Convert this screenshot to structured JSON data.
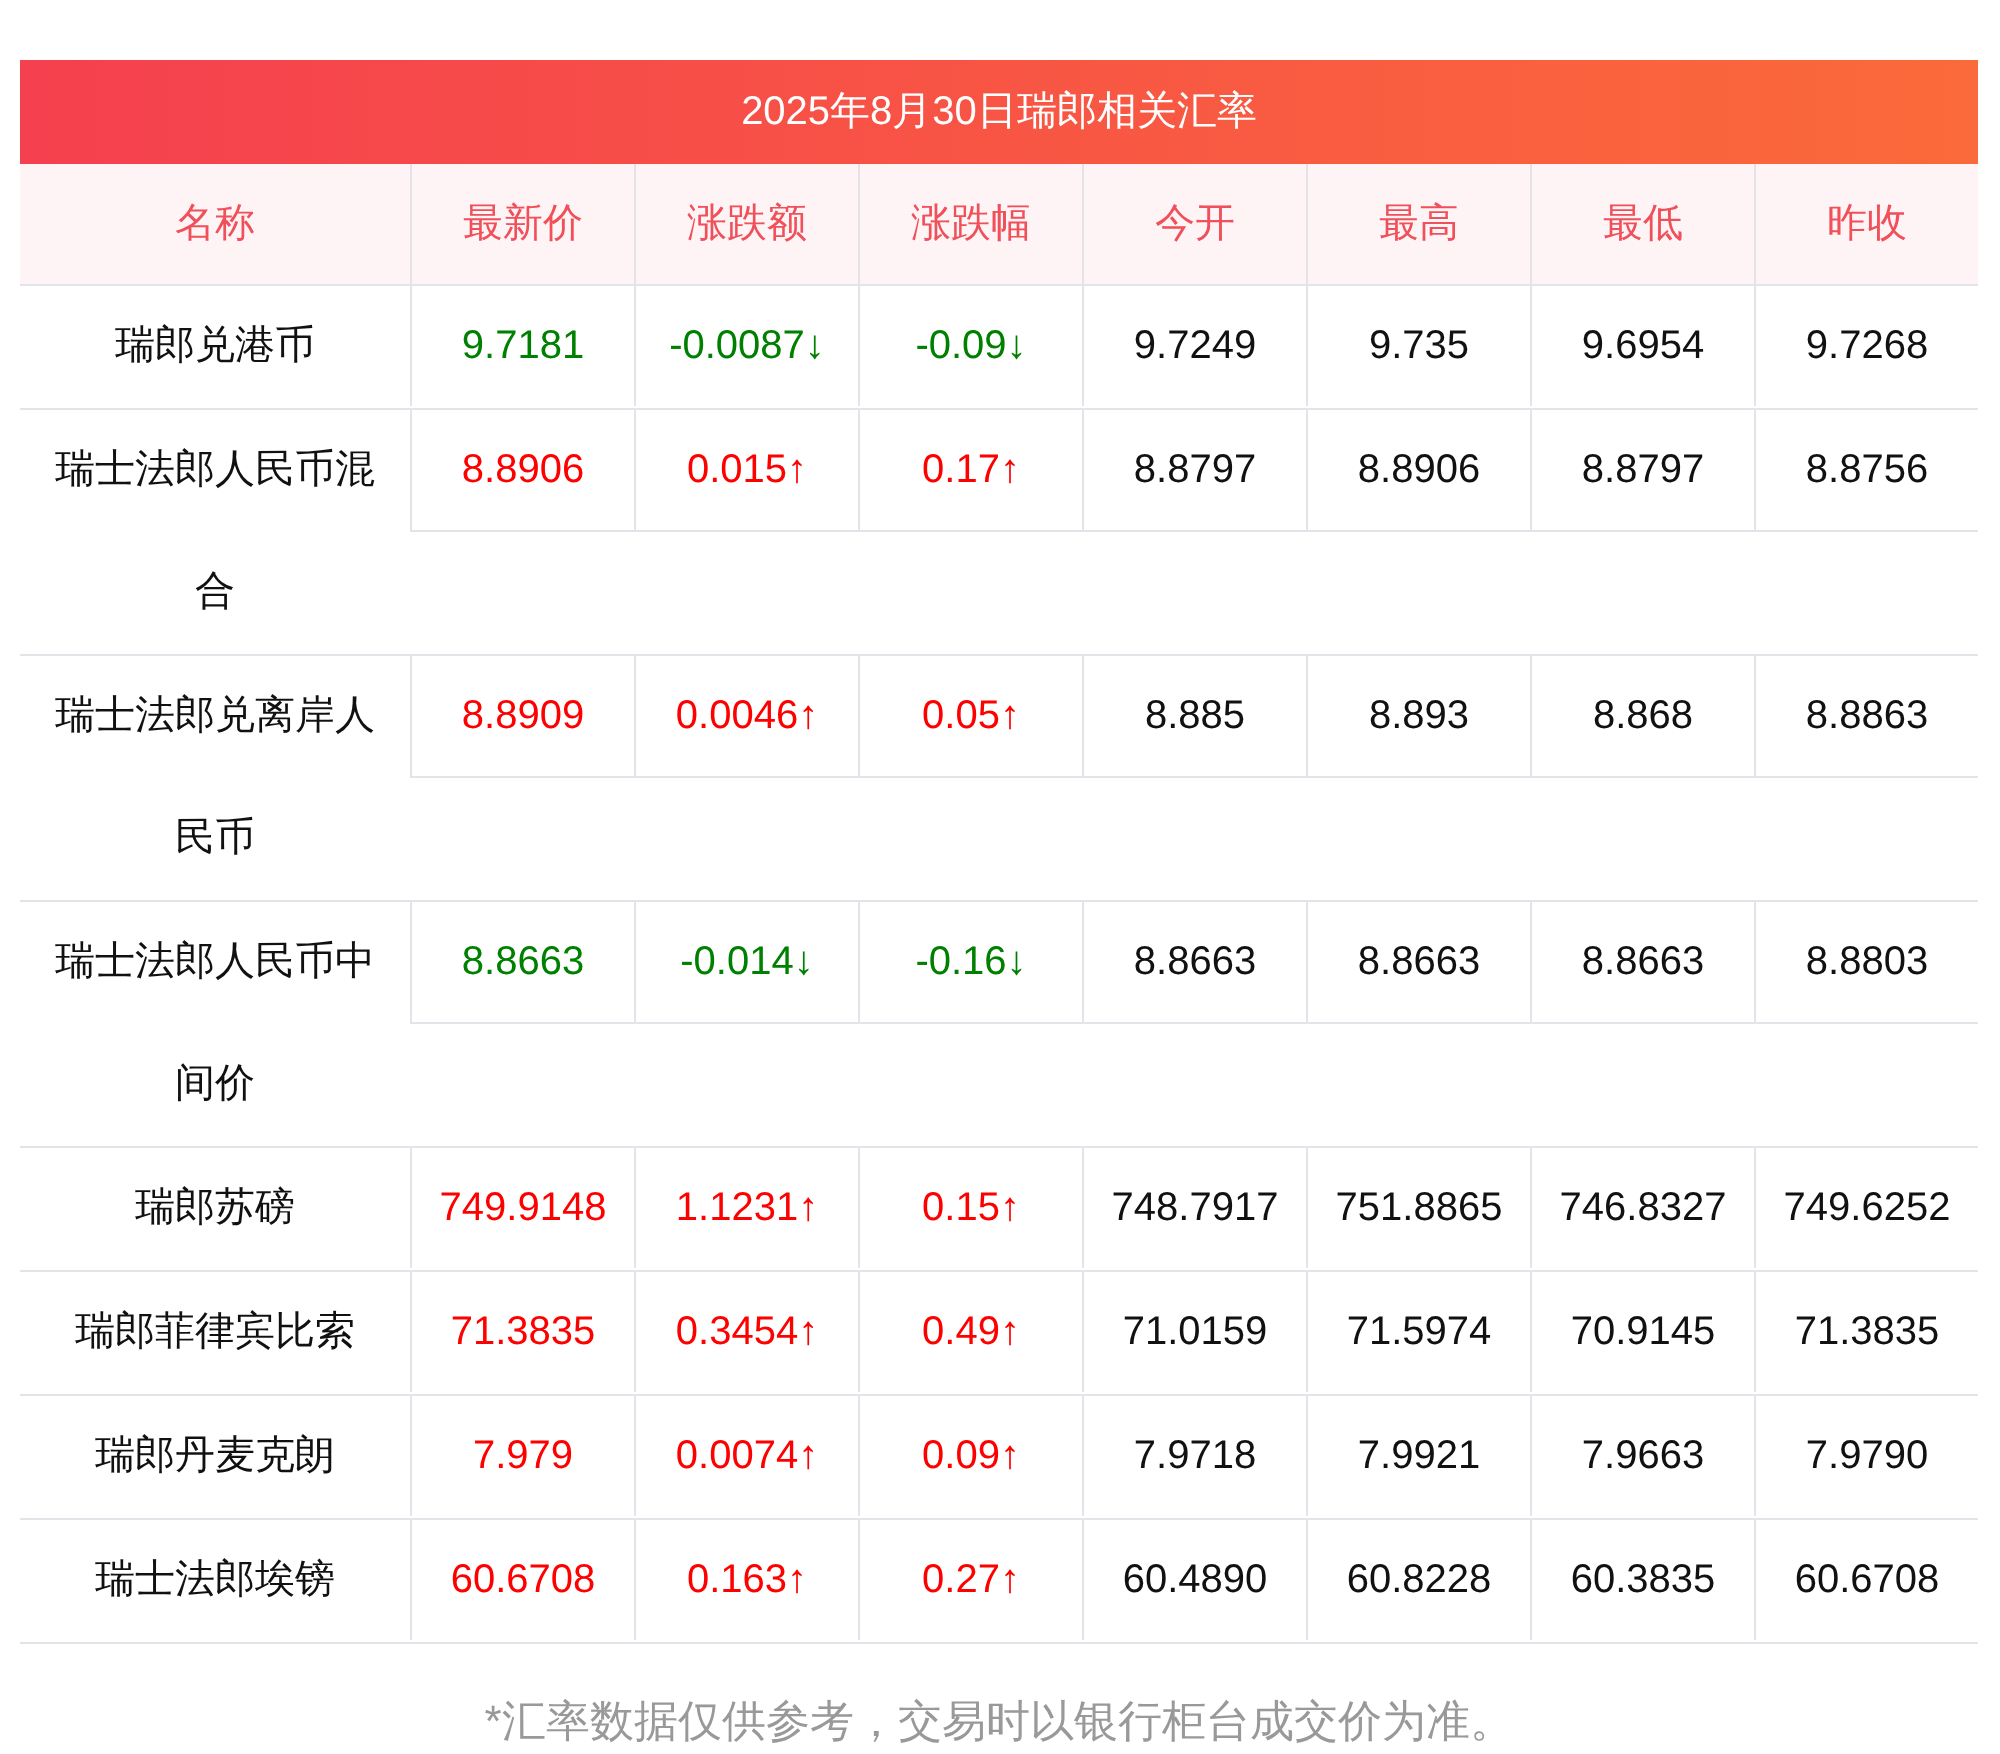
{
  "title": "2025年8月30日瑞郎相关汇率",
  "columns": [
    "名称",
    "最新价",
    "涨跌额",
    "涨跌幅",
    "今开",
    "最高",
    "最低",
    "昨收"
  ],
  "rows": [
    {
      "name": "瑞郎兑港币",
      "color": "#008000",
      "latest": "9.7181",
      "change": "-0.0087↓",
      "change_pct": "-0.09↓",
      "open": "9.7249",
      "high": "9.735",
      "low": "9.6954",
      "prev_close": "9.7268"
    },
    {
      "name": "瑞士法郎人民币混合",
      "color": "#ff0000",
      "latest": "8.8906",
      "change": "0.015↑",
      "change_pct": "0.17↑",
      "open": "8.8797",
      "high": "8.8906",
      "low": "8.8797",
      "prev_close": "8.8756"
    },
    {
      "name": "瑞士法郎兑离岸人民币",
      "color": "#ff0000",
      "latest": "8.8909",
      "change": "0.0046↑",
      "change_pct": "0.05↑",
      "open": "8.885",
      "high": "8.893",
      "low": "8.868",
      "prev_close": "8.8863"
    },
    {
      "name": "瑞士法郎人民币中间价",
      "color": "#008000",
      "latest": "8.8663",
      "change": "-0.014↓",
      "change_pct": "-0.16↓",
      "open": "8.8663",
      "high": "8.8663",
      "low": "8.8663",
      "prev_close": "8.8803"
    },
    {
      "name": "瑞郎苏磅",
      "color": "#ff0000",
      "latest": "749.9148",
      "change": "1.1231↑",
      "change_pct": "0.15↑",
      "open": "748.7917",
      "high": "751.8865",
      "low": "746.8327",
      "prev_close": "749.6252"
    },
    {
      "name": "瑞郎菲律宾比索",
      "color": "#ff0000",
      "latest": "71.3835",
      "change": "0.3454↑",
      "change_pct": "0.49↑",
      "open": "71.0159",
      "high": "71.5974",
      "low": "70.9145",
      "prev_close": "71.3835"
    },
    {
      "name": "瑞郎丹麦克朗",
      "color": "#ff0000",
      "latest": "7.979",
      "change": "0.0074↑",
      "change_pct": "0.09↑",
      "open": "7.9718",
      "high": "7.9921",
      "low": "7.9663",
      "prev_close": "7.9790"
    },
    {
      "name": "瑞士法郎埃镑",
      "color": "#ff0000",
      "latest": "60.6708",
      "change": "0.163↑",
      "change_pct": "0.27↑",
      "open": "60.4890",
      "high": "60.8228",
      "low": "60.3835",
      "prev_close": "60.6708"
    }
  ],
  "footnote": "*汇率数据仅供参考，交易时以银行柜台成交价为准。"
}
